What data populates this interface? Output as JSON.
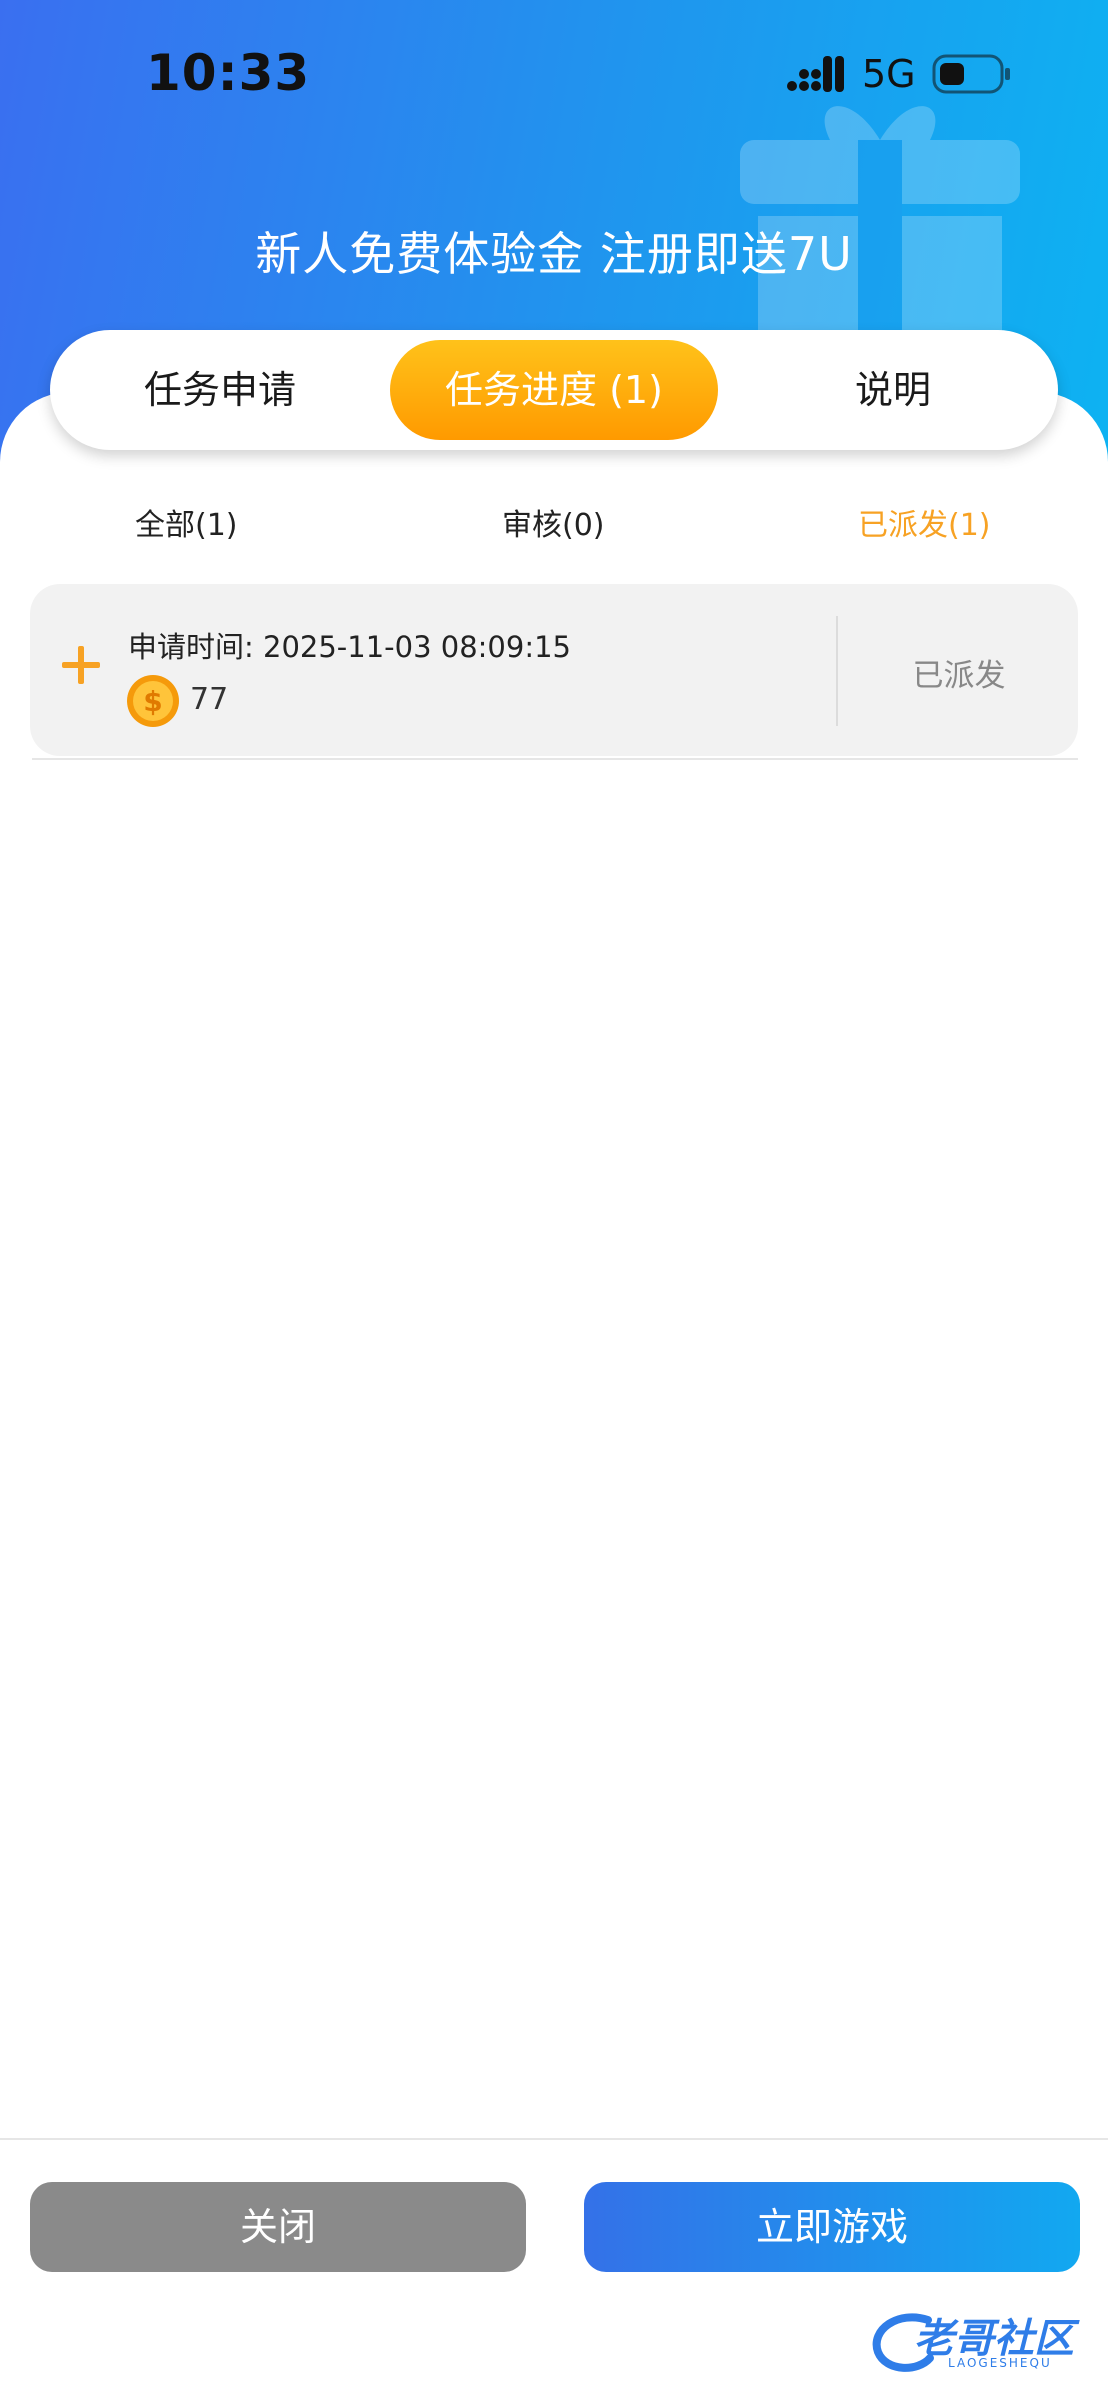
{
  "status_bar": {
    "time": "10:33",
    "network": "5G"
  },
  "banner": {
    "title": "新人免费体验金 注册即送7U"
  },
  "tabs": [
    {
      "label": "任务申请",
      "active": false
    },
    {
      "label": "任务进度 (1)",
      "active": true
    },
    {
      "label": "说明",
      "active": false
    }
  ],
  "filters": [
    {
      "label": "全部(1)",
      "active": false
    },
    {
      "label": "审核(0)",
      "active": false
    },
    {
      "label": "已派发(1)",
      "active": true
    }
  ],
  "records": [
    {
      "apply_time": "申请时间: 2025-11-03 08:09:15",
      "amount": "77",
      "status": "已派发",
      "icons": [
        "plus-icon",
        "coin-icon"
      ]
    }
  ],
  "buttons": {
    "close": "关闭",
    "play": "立即游戏"
  },
  "watermark": {
    "text": "老哥社区",
    "sub": "LAOGESHEQU"
  },
  "colors": {
    "header_gradient_start": "#3a6ff0",
    "header_gradient_end": "#0db3f2",
    "active_tab": "#ff9a00",
    "active_filter": "#f7a224",
    "close_button": "#8a8a8a",
    "play_button_start": "#3471e8",
    "play_button_end": "#12a8f0"
  }
}
